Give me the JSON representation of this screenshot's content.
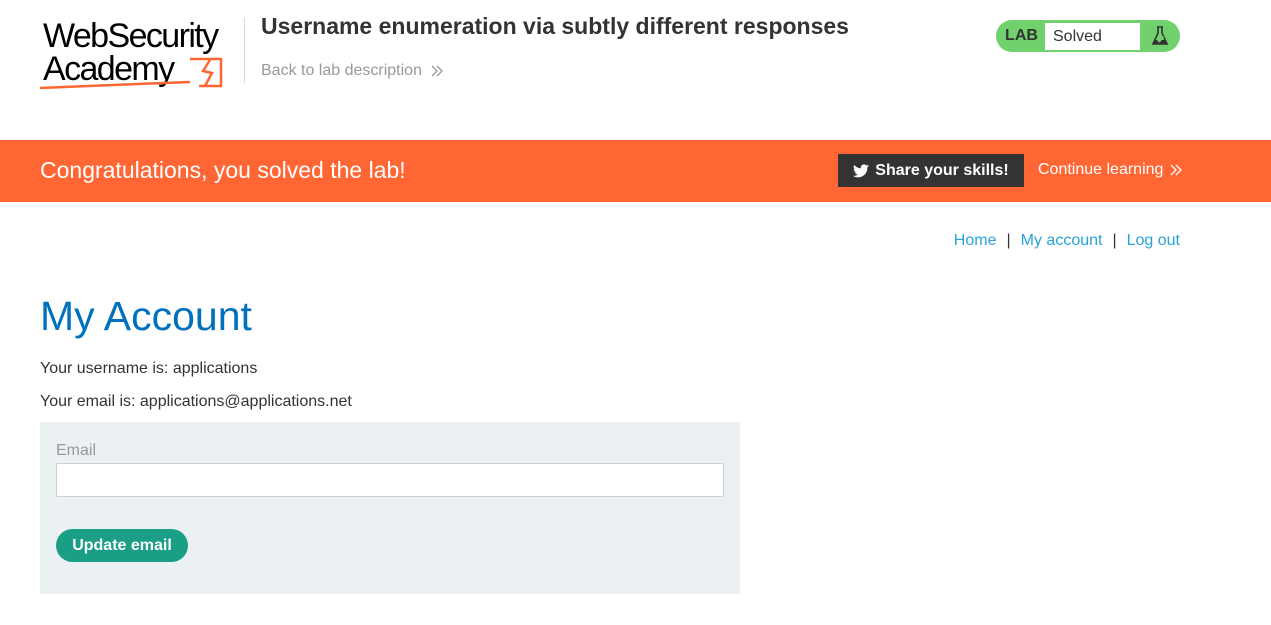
{
  "logo": {
    "line1": "WebSecurity",
    "line2": "Academy",
    "brand_color": "#ff6633"
  },
  "header": {
    "lab_title": "Username enumeration via subtly different responses",
    "back_link": "Back to lab description",
    "back_icon": "double-chevron-right-icon"
  },
  "lab_status": {
    "tag": "LAB",
    "state": "Solved",
    "icon": "flask-icon",
    "color": "#70d16d"
  },
  "banner": {
    "message": "Congratulations, you solved the lab!",
    "share_label": "Share your skills!",
    "share_icon": "twitter-icon",
    "continue_label": "Continue learning",
    "background": "#ff6633"
  },
  "nav": {
    "home": "Home",
    "separator": "|",
    "my_account": "My account",
    "logout": "Log out"
  },
  "account": {
    "title": "My Account",
    "username_line": "Your username is: applications",
    "email_line": "Your email is: applications@applications.net"
  },
  "form": {
    "email_label": "Email",
    "email_value": "",
    "submit_label": "Update email",
    "button_color": "#1a9e85"
  }
}
